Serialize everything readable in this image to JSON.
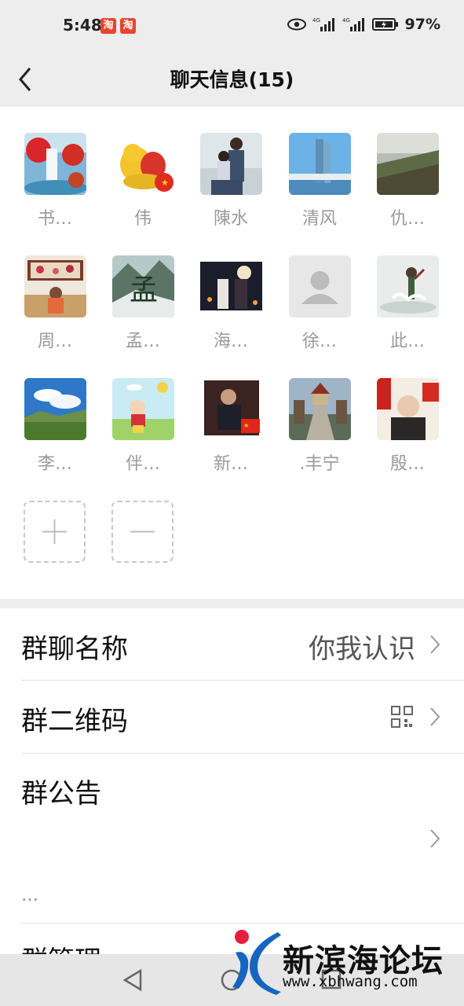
{
  "status_bar": {
    "time": "5:48",
    "app_badges": [
      "淘",
      "淘"
    ],
    "network": "4G",
    "battery": "97%"
  },
  "header": {
    "title": "聊天信息(15)"
  },
  "members": [
    {
      "name": "书…"
    },
    {
      "name": "伟"
    },
    {
      "name": "陳水"
    },
    {
      "name": "清风"
    },
    {
      "name": "仇…"
    },
    {
      "name": "周…"
    },
    {
      "name": "孟…"
    },
    {
      "name": "海…"
    },
    {
      "name": "徐…"
    },
    {
      "name": "此…"
    },
    {
      "name": "李…"
    },
    {
      "name": "伴…"
    },
    {
      "name": "新…"
    },
    {
      "name": ".丰宁"
    },
    {
      "name": "殷…"
    }
  ],
  "settings": {
    "group_name_label": "群聊名称",
    "group_name_value": "你我认识",
    "qr_label": "群二维码",
    "notice_label": "群公告",
    "notice_more": "…",
    "manage_label": "群管理"
  },
  "watermark": {
    "name": "新滨海论坛",
    "url": "www.xbhwang.com"
  },
  "icons": {
    "back": "chevron-left-icon",
    "chevron": "chevron-right-icon",
    "qr": "qr-code-icon",
    "add": "plus-icon",
    "remove": "minus-icon"
  }
}
